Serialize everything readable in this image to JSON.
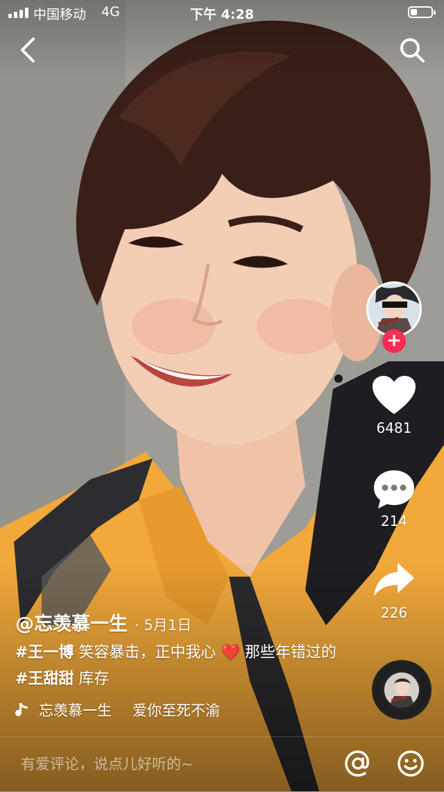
{
  "status_bar": {
    "carrier": "中国移动",
    "network": "4G",
    "time": "下午 4:28"
  },
  "icons": {
    "back": "chevron-left-icon",
    "search": "search-icon",
    "like": "heart-icon",
    "comment": "speech-bubble-icon",
    "share": "share-arrow-icon",
    "follow": "plus-icon",
    "music": "music-note-icon",
    "mention": "at-sign-icon",
    "emoji": "smiley-icon"
  },
  "actions": {
    "follow_label": "+",
    "likes": "6481",
    "comments": "214",
    "shares": "226"
  },
  "caption": {
    "author": "@忘羡慕一生",
    "date": "· 5月1日",
    "hashtag_1": "#王一博",
    "text_1": " 笑容暴击，正中我心 ",
    "heart": "❤️",
    "text_2": " 那些年错过的",
    "hashtag_2": "#王甜甜",
    "text_3": " 库存"
  },
  "music": {
    "creator": "忘羡慕一生",
    "song": "爱你至死不渝"
  },
  "comment_bar": {
    "placeholder": "有爱评论，说点儿好听的~"
  },
  "colors": {
    "accent": "#fe2c55",
    "heart_emoji": "#e8283a",
    "jacket": "#f2a93a"
  }
}
